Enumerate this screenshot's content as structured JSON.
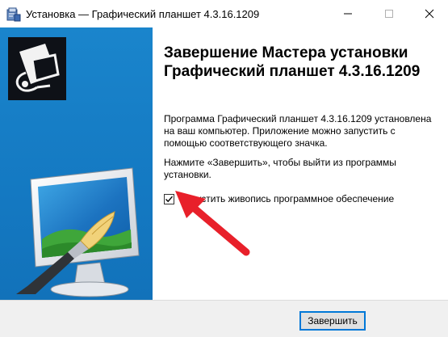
{
  "window": {
    "title": "Установка — Графический планшет 4.3.16.1209"
  },
  "content": {
    "heading": "Завершение Мастера установки Графический планшет 4.3.16.1209",
    "paragraph1": "Программа Графический планшет 4.3.16.1209 установлена на ваш компьютер. Приложение можно запустить с помощью соответствующего значка.",
    "paragraph2": "Нажмите «Завершить», чтобы выйти из программы установки.",
    "checkbox": {
      "label": "Запустить живопись программное обеспечение",
      "checked": true
    }
  },
  "footer": {
    "finish_label": "Завершить"
  },
  "colors": {
    "banner": "#1680c8",
    "button_border": "#0078d7",
    "annotation": "#e8202a"
  },
  "icons": [
    "installer-app-icon",
    "minimize-icon",
    "maximize-icon",
    "close-icon",
    "tablet-logo-icon",
    "monitor-brush-illustration",
    "checkmark-icon",
    "annotation-arrow"
  ]
}
